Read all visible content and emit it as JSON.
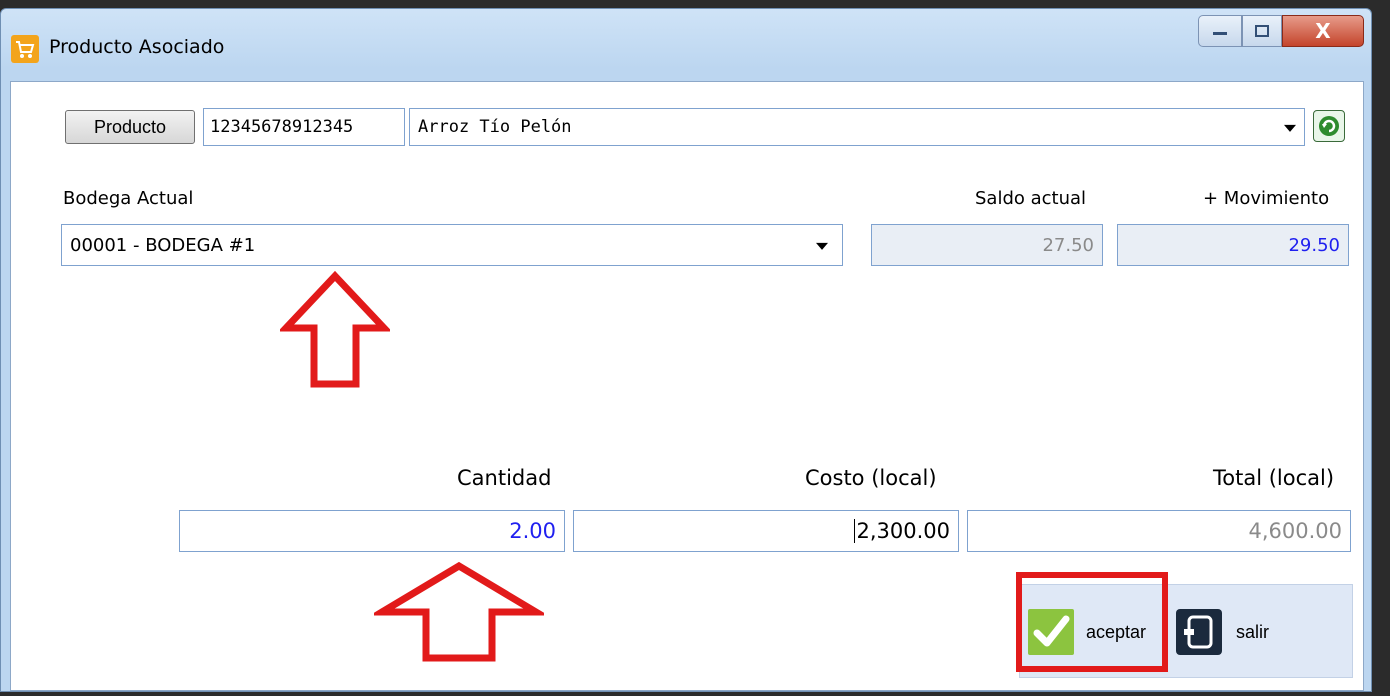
{
  "window": {
    "title": "Producto Asociado",
    "controls": {
      "minimize": "minimize",
      "maximize": "maximize",
      "close": "X"
    }
  },
  "product": {
    "button_label": "Producto",
    "code": "12345678912345",
    "name": "Arroz Tío Pelón"
  },
  "bodega": {
    "label": "Bodega Actual",
    "selected": "00001 - BODEGA #1"
  },
  "saldo": {
    "label": "Saldo actual",
    "value": "27.50"
  },
  "movimiento": {
    "label": "+ Movimiento",
    "value": "29.50"
  },
  "amounts": {
    "cantidad_label": "Cantidad",
    "cantidad_value": "2.00",
    "costo_label": "Costo (local)",
    "costo_value": "2,300.00",
    "total_label": "Total (local)",
    "total_value": "4,600.00"
  },
  "actions": {
    "accept_label": "aceptar",
    "exit_label": "salir"
  },
  "colors": {
    "annotation_red": "#e21a1a",
    "value_blue": "#1f1ff0",
    "accept_green": "#8cc43f"
  },
  "icons": [
    "shopping-cart-icon",
    "dropdown-arrow-icon",
    "refresh-icon",
    "checkmark-icon",
    "exit-door-icon"
  ]
}
